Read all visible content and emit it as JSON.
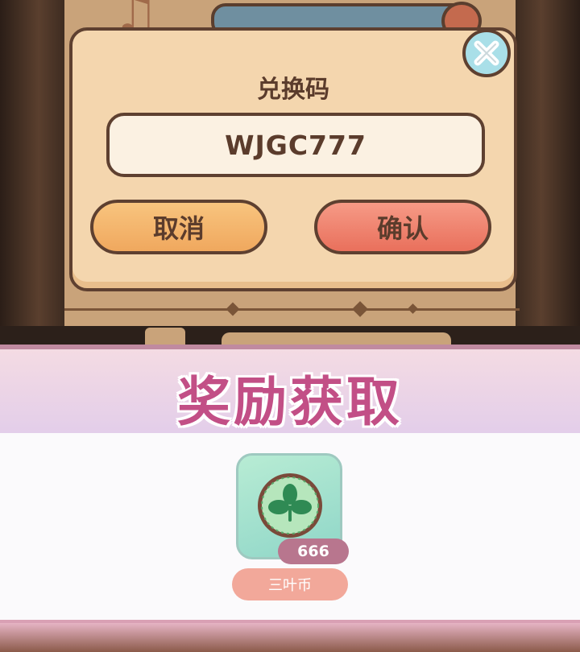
{
  "dialog": {
    "title": "兑换码",
    "code_value": "WJGC777",
    "cancel_label": "取消",
    "confirm_label": "确认"
  },
  "reward": {
    "title": "奖励获取",
    "item": {
      "name": "三叶币",
      "count": "666",
      "icon": "clover-coin-icon"
    }
  },
  "colors": {
    "dialog_bg": "#f4d6ae",
    "cancel_button": "#f0a85e",
    "confirm_button": "#e9705c",
    "reward_title": "#c24f86",
    "close_button": "#a9dfe8"
  }
}
